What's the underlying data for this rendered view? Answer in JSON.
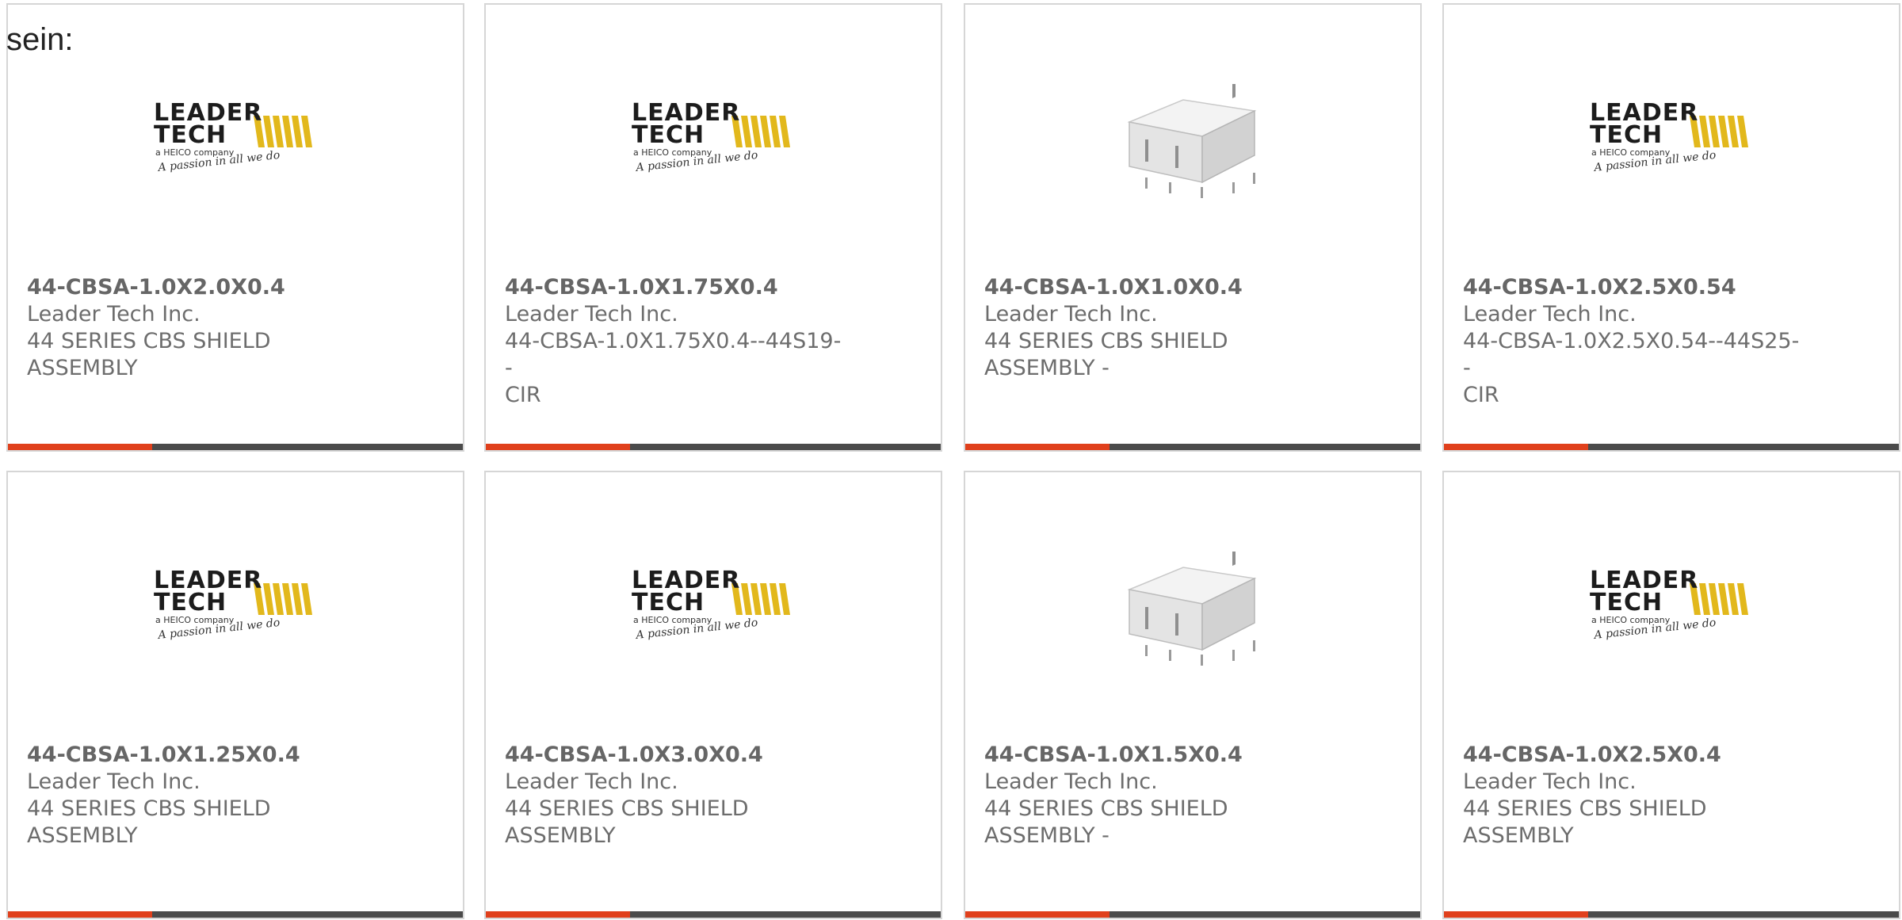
{
  "prefix_text": "sein:",
  "colors": {
    "accent": "#e0401c",
    "bar_dark": "#4b4b4b",
    "text_gray": "#6d6d6d",
    "logo_yellow": "#e2b81c"
  },
  "logo": {
    "line1": "LEADER",
    "line2": "TECH",
    "line3": "a HEICO company",
    "tagline": "A passion in all we do"
  },
  "products": [
    {
      "part": "44-CBSA-1.0X2.0X0.4",
      "manufacturer": "Leader Tech Inc.",
      "desc1": "44 SERIES CBS SHIELD",
      "desc2": "ASSEMBLY",
      "image": "leader-tech-logo"
    },
    {
      "part": "44-CBSA-1.0X1.75X0.4",
      "manufacturer": "Leader Tech Inc.",
      "desc1": "44-CBSA-1.0X1.75X0.4--44S19--",
      "desc2": "CIR",
      "image": "leader-tech-logo"
    },
    {
      "part": "44-CBSA-1.0X1.0X0.4",
      "manufacturer": "Leader Tech Inc.",
      "desc1": "44 SERIES CBS SHIELD",
      "desc2": "ASSEMBLY -",
      "image": "shield-component"
    },
    {
      "part": "44-CBSA-1.0X2.5X0.54",
      "manufacturer": "Leader Tech Inc.",
      "desc1": "44-CBSA-1.0X2.5X0.54--44S25--",
      "desc2": "CIR",
      "image": "leader-tech-logo"
    },
    {
      "part": "44-CBSA-1.0X1.25X0.4",
      "manufacturer": "Leader Tech Inc.",
      "desc1": "44 SERIES CBS SHIELD",
      "desc2": "ASSEMBLY",
      "image": "leader-tech-logo"
    },
    {
      "part": "44-CBSA-1.0X3.0X0.4",
      "manufacturer": "Leader Tech Inc.",
      "desc1": "44 SERIES CBS SHIELD",
      "desc2": "ASSEMBLY",
      "image": "leader-tech-logo"
    },
    {
      "part": "44-CBSA-1.0X1.5X0.4",
      "manufacturer": "Leader Tech Inc.",
      "desc1": "44 SERIES CBS SHIELD",
      "desc2": "ASSEMBLY -",
      "image": "shield-component"
    },
    {
      "part": "44-CBSA-1.0X2.5X0.4",
      "manufacturer": "Leader Tech Inc.",
      "desc1": "44 SERIES CBS SHIELD",
      "desc2": "ASSEMBLY",
      "image": "leader-tech-logo"
    }
  ]
}
